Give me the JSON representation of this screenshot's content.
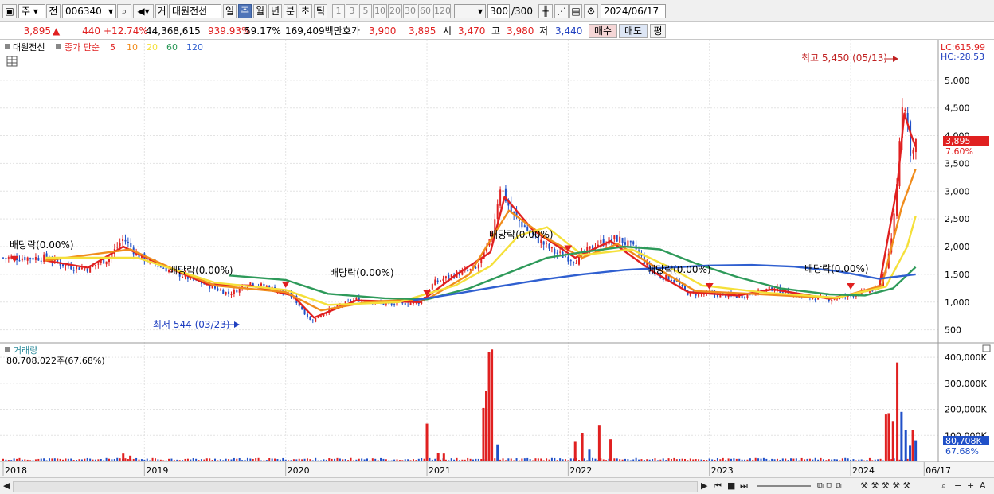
{
  "toolbar": {
    "market_type": "주",
    "prev_button": "전",
    "stock_code": "006340",
    "gu_button": "거",
    "stock_name": "대원전선",
    "periods": [
      "일",
      "주",
      "월",
      "년",
      "분",
      "초",
      "틱"
    ],
    "selected_period": "주",
    "intervals": [
      "1",
      "3",
      "5",
      "10",
      "20",
      "30",
      "60",
      "120"
    ],
    "count_display": "300",
    "count_total": "/300",
    "date": "2024/06/17"
  },
  "quote": {
    "price": "3,895",
    "up_arrow": "▲",
    "change": "440",
    "change_pct": "+12.74%",
    "volume": "44,368,615",
    "volume_ratio": "939.93%",
    "turnover_pct": "59.17%",
    "amount": "169,409백만",
    "hoga_label": "호가",
    "hoga_ask": "3,900",
    "hoga_bid": "3,895",
    "open_label": "시",
    "open": "3,470",
    "high_label": "고",
    "high": "3,980",
    "low_label": "저",
    "low": "3,440",
    "buy_button": "매수",
    "sell_button": "매도",
    "avg_button": "평"
  },
  "legend": {
    "name": "대원전선",
    "ma_label": "종가 단순",
    "ma_periods": [
      "5",
      "10",
      "20",
      "60",
      "120"
    ],
    "ma_colors": [
      "#e02020",
      "#f08c1c",
      "#f5e03a",
      "#2e9a5a",
      "#2f5fd0"
    ]
  },
  "price_axis": {
    "lc": "LC:615.99",
    "hc": "HC:-28.53",
    "current_badge": "3,895",
    "current_pct": "7.60%"
  },
  "annotations": {
    "max_label": "최고 5,450 (05/13)",
    "min_label": "최저 544 (03/23)",
    "dividend_labels": [
      "배당락(0.00%)",
      "배당락(0.00%)",
      "배당락(0.00%)",
      "배당락(0.00%)",
      "배당락(0.00%)",
      "배당락(0.00%)"
    ]
  },
  "volume_panel": {
    "title": "거래량",
    "value_line": "80,708,022주(67.68%)",
    "current_badge": "80,708K",
    "current_pct": "67.68%"
  },
  "x_axis_labels": [
    "2018",
    "2019",
    "2020",
    "2021",
    "2022",
    "2023",
    "2024",
    "06/17"
  ],
  "chart_data": [
    {
      "type": "candlestick",
      "title": "대원전선",
      "y_ticks": [
        500,
        1000,
        1500,
        2000,
        2500,
        3000,
        3500,
        4000,
        4500,
        5000
      ],
      "y_tick_labels": [
        "500",
        "1,000",
        "1,500",
        "2,000",
        "2,500",
        "3,000",
        "3,500",
        "4,000",
        "4,500",
        "5,000"
      ],
      "ylim": [
        280,
        5700
      ],
      "x_labels": [
        "2018",
        "2019",
        "2020",
        "2021",
        "2022",
        "2023",
        "2024",
        "06/17"
      ],
      "close_path": [
        {
          "x": 2018.3,
          "y": 1800
        },
        {
          "x": 2018.45,
          "y": 1650
        },
        {
          "x": 2018.6,
          "y": 1600
        },
        {
          "x": 2018.75,
          "y": 1800
        },
        {
          "x": 2018.85,
          "y": 2150
        },
        {
          "x": 2018.95,
          "y": 1850
        },
        {
          "x": 2019.1,
          "y": 1650
        },
        {
          "x": 2019.25,
          "y": 1500
        },
        {
          "x": 2019.45,
          "y": 1300
        },
        {
          "x": 2019.6,
          "y": 1150
        },
        {
          "x": 2019.75,
          "y": 1350
        },
        {
          "x": 2019.9,
          "y": 1250
        },
        {
          "x": 2020.05,
          "y": 1100
        },
        {
          "x": 2020.18,
          "y": 650
        },
        {
          "x": 2020.3,
          "y": 850
        },
        {
          "x": 2020.5,
          "y": 1050
        },
        {
          "x": 2020.75,
          "y": 950
        },
        {
          "x": 2020.95,
          "y": 1000
        },
        {
          "x": 2021.05,
          "y": 1350
        },
        {
          "x": 2021.2,
          "y": 1500
        },
        {
          "x": 2021.35,
          "y": 1600
        },
        {
          "x": 2021.45,
          "y": 2100
        },
        {
          "x": 2021.52,
          "y": 3100
        },
        {
          "x": 2021.6,
          "y": 2600
        },
        {
          "x": 2021.75,
          "y": 2200
        },
        {
          "x": 2021.9,
          "y": 1900
        },
        {
          "x": 2022.05,
          "y": 1750
        },
        {
          "x": 2022.2,
          "y": 2050
        },
        {
          "x": 2022.35,
          "y": 2150
        },
        {
          "x": 2022.48,
          "y": 1950
        },
        {
          "x": 2022.6,
          "y": 1500
        },
        {
          "x": 2022.75,
          "y": 1400
        },
        {
          "x": 2022.85,
          "y": 1150
        },
        {
          "x": 2023.0,
          "y": 1150
        },
        {
          "x": 2023.2,
          "y": 1100
        },
        {
          "x": 2023.45,
          "y": 1250
        },
        {
          "x": 2023.65,
          "y": 1100
        },
        {
          "x": 2023.85,
          "y": 1050
        },
        {
          "x": 2024.05,
          "y": 1150
        },
        {
          "x": 2024.2,
          "y": 1250
        },
        {
          "x": 2024.28,
          "y": 1900
        },
        {
          "x": 2024.33,
          "y": 3200
        },
        {
          "x": 2024.36,
          "y": 4700
        },
        {
          "x": 2024.4,
          "y": 4300
        },
        {
          "x": 2024.43,
          "y": 3600
        },
        {
          "x": 2024.46,
          "y": 3895
        }
      ],
      "ma": [
        {
          "name": "5",
          "points": [
            {
              "x": 2018.3,
              "y": 1750
            },
            {
              "x": 2018.6,
              "y": 1620
            },
            {
              "x": 2018.85,
              "y": 2000
            },
            {
              "x": 2019.1,
              "y": 1700
            },
            {
              "x": 2019.45,
              "y": 1320
            },
            {
              "x": 2019.75,
              "y": 1300
            },
            {
              "x": 2020.05,
              "y": 1120
            },
            {
              "x": 2020.2,
              "y": 720
            },
            {
              "x": 2020.5,
              "y": 1030
            },
            {
              "x": 2020.95,
              "y": 1000
            },
            {
              "x": 2021.2,
              "y": 1480
            },
            {
              "x": 2021.45,
              "y": 1900
            },
            {
              "x": 2021.55,
              "y": 2900
            },
            {
              "x": 2021.75,
              "y": 2300
            },
            {
              "x": 2022.05,
              "y": 1800
            },
            {
              "x": 2022.3,
              "y": 2100
            },
            {
              "x": 2022.6,
              "y": 1550
            },
            {
              "x": 2022.85,
              "y": 1180
            },
            {
              "x": 2023.2,
              "y": 1120
            },
            {
              "x": 2023.45,
              "y": 1230
            },
            {
              "x": 2023.85,
              "y": 1060
            },
            {
              "x": 2024.2,
              "y": 1250
            },
            {
              "x": 2024.33,
              "y": 3100
            },
            {
              "x": 2024.38,
              "y": 4400
            },
            {
              "x": 2024.43,
              "y": 4000
            },
            {
              "x": 2024.46,
              "y": 3800
            }
          ]
        },
        {
          "name": "10",
          "points": [
            {
              "x": 2018.3,
              "y": 1750
            },
            {
              "x": 2018.9,
              "y": 1950
            },
            {
              "x": 2019.2,
              "y": 1600
            },
            {
              "x": 2019.5,
              "y": 1300
            },
            {
              "x": 2020.0,
              "y": 1180
            },
            {
              "x": 2020.25,
              "y": 850
            },
            {
              "x": 2020.6,
              "y": 1010
            },
            {
              "x": 2021.0,
              "y": 1050
            },
            {
              "x": 2021.3,
              "y": 1500
            },
            {
              "x": 2021.58,
              "y": 2650
            },
            {
              "x": 2021.85,
              "y": 2150
            },
            {
              "x": 2022.1,
              "y": 1800
            },
            {
              "x": 2022.35,
              "y": 2050
            },
            {
              "x": 2022.65,
              "y": 1580
            },
            {
              "x": 2022.9,
              "y": 1200
            },
            {
              "x": 2023.3,
              "y": 1150
            },
            {
              "x": 2023.9,
              "y": 1070
            },
            {
              "x": 2024.22,
              "y": 1300
            },
            {
              "x": 2024.36,
              "y": 2700
            },
            {
              "x": 2024.46,
              "y": 3400
            }
          ]
        },
        {
          "name": "20",
          "points": [
            {
              "x": 2018.3,
              "y": 1800
            },
            {
              "x": 2018.95,
              "y": 1800
            },
            {
              "x": 2019.5,
              "y": 1350
            },
            {
              "x": 2020.0,
              "y": 1220
            },
            {
              "x": 2020.3,
              "y": 950
            },
            {
              "x": 2020.8,
              "y": 1000
            },
            {
              "x": 2021.2,
              "y": 1300
            },
            {
              "x": 2021.45,
              "y": 1650
            },
            {
              "x": 2021.65,
              "y": 2200
            },
            {
              "x": 2021.85,
              "y": 2350
            },
            {
              "x": 2022.1,
              "y": 1850
            },
            {
              "x": 2022.45,
              "y": 1950
            },
            {
              "x": 2022.7,
              "y": 1650
            },
            {
              "x": 2022.95,
              "y": 1300
            },
            {
              "x": 2023.4,
              "y": 1170
            },
            {
              "x": 2023.9,
              "y": 1080
            },
            {
              "x": 2024.25,
              "y": 1280
            },
            {
              "x": 2024.4,
              "y": 2000
            },
            {
              "x": 2024.46,
              "y": 2550
            }
          ]
        },
        {
          "name": "60",
          "points": [
            {
              "x": 2019.6,
              "y": 1480
            },
            {
              "x": 2020.0,
              "y": 1400
            },
            {
              "x": 2020.3,
              "y": 1150
            },
            {
              "x": 2020.7,
              "y": 1070
            },
            {
              "x": 2021.0,
              "y": 1050
            },
            {
              "x": 2021.3,
              "y": 1250
            },
            {
              "x": 2021.55,
              "y": 1500
            },
            {
              "x": 2021.85,
              "y": 1800
            },
            {
              "x": 2022.1,
              "y": 1900
            },
            {
              "x": 2022.4,
              "y": 2000
            },
            {
              "x": 2022.65,
              "y": 1950
            },
            {
              "x": 2022.9,
              "y": 1700
            },
            {
              "x": 2023.2,
              "y": 1450
            },
            {
              "x": 2023.5,
              "y": 1250
            },
            {
              "x": 2023.85,
              "y": 1140
            },
            {
              "x": 2024.1,
              "y": 1120
            },
            {
              "x": 2024.3,
              "y": 1250
            },
            {
              "x": 2024.46,
              "y": 1630
            }
          ]
        },
        {
          "name": "120",
          "points": [
            {
              "x": 2020.9,
              "y": 1030
            },
            {
              "x": 2021.2,
              "y": 1150
            },
            {
              "x": 2021.5,
              "y": 1280
            },
            {
              "x": 2021.8,
              "y": 1400
            },
            {
              "x": 2022.1,
              "y": 1500
            },
            {
              "x": 2022.4,
              "y": 1580
            },
            {
              "x": 2022.7,
              "y": 1620
            },
            {
              "x": 2023.0,
              "y": 1660
            },
            {
              "x": 2023.3,
              "y": 1670
            },
            {
              "x": 2023.6,
              "y": 1640
            },
            {
              "x": 2023.9,
              "y": 1560
            },
            {
              "x": 2024.2,
              "y": 1420
            },
            {
              "x": 2024.46,
              "y": 1500
            }
          ]
        }
      ]
    },
    {
      "type": "bar",
      "title": "거래량",
      "y_tick_labels": [
        "100,000K",
        "200,000K",
        "300,000K",
        "400,000K"
      ],
      "y_ticks": [
        100000,
        200000,
        300000,
        400000
      ],
      "ylim": [
        0,
        440000
      ],
      "bars": [
        {
          "x": 2018.85,
          "v": 30000,
          "c": "#e02020"
        },
        {
          "x": 2018.9,
          "v": 22000,
          "c": "#e02020"
        },
        {
          "x": 2021.0,
          "v": 145000,
          "c": "#e02020"
        },
        {
          "x": 2021.08,
          "v": 32000,
          "c": "#e02020"
        },
        {
          "x": 2021.12,
          "v": 30000,
          "c": "#e02020"
        },
        {
          "x": 2021.4,
          "v": 205000,
          "c": "#e02020"
        },
        {
          "x": 2021.42,
          "v": 270000,
          "c": "#e02020"
        },
        {
          "x": 2021.44,
          "v": 420000,
          "c": "#e02020"
        },
        {
          "x": 2021.46,
          "v": 430000,
          "c": "#e02020"
        },
        {
          "x": 2021.5,
          "v": 65000,
          "c": "#2050c8"
        },
        {
          "x": 2022.05,
          "v": 75000,
          "c": "#e02020"
        },
        {
          "x": 2022.1,
          "v": 110000,
          "c": "#e02020"
        },
        {
          "x": 2022.15,
          "v": 45000,
          "c": "#2050c8"
        },
        {
          "x": 2022.22,
          "v": 140000,
          "c": "#e02020"
        },
        {
          "x": 2022.3,
          "v": 85000,
          "c": "#e02020"
        },
        {
          "x": 2024.25,
          "v": 180000,
          "c": "#e02020"
        },
        {
          "x": 2024.27,
          "v": 185000,
          "c": "#e02020"
        },
        {
          "x": 2024.3,
          "v": 155000,
          "c": "#e02020"
        },
        {
          "x": 2024.33,
          "v": 380000,
          "c": "#e02020"
        },
        {
          "x": 2024.36,
          "v": 190000,
          "c": "#2050c8"
        },
        {
          "x": 2024.39,
          "v": 120000,
          "c": "#2050c8"
        },
        {
          "x": 2024.42,
          "v": 60000,
          "c": "#2050c8"
        },
        {
          "x": 2024.44,
          "v": 120000,
          "c": "#e02020"
        },
        {
          "x": 2024.46,
          "v": 80708,
          "c": "#2050c8"
        }
      ]
    }
  ]
}
